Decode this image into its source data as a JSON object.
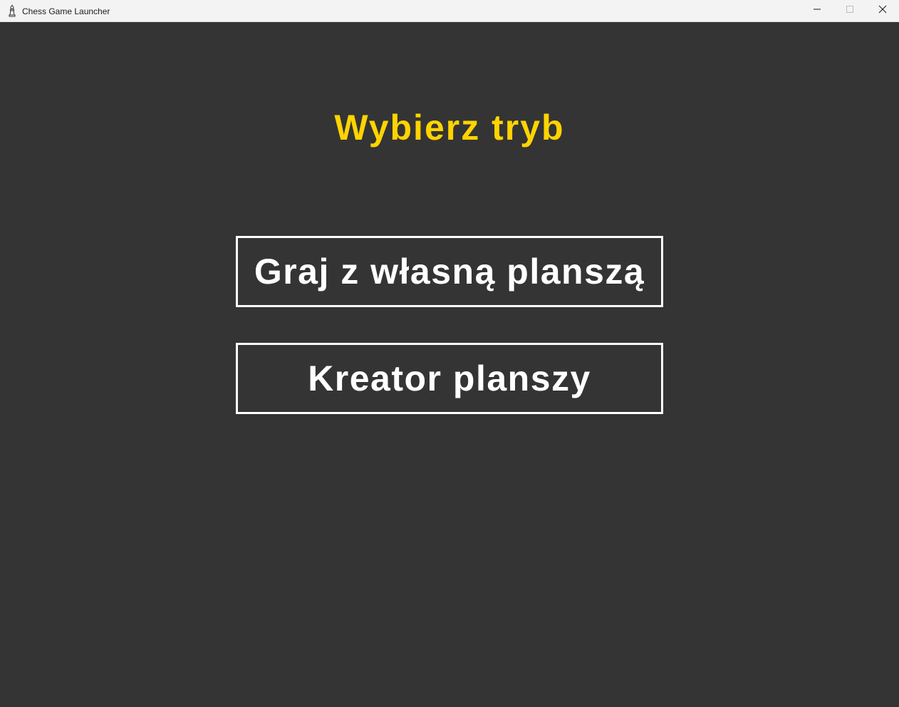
{
  "window": {
    "title": "Chess Game Launcher",
    "icon": "chess-piece-icon",
    "controls": {
      "minimize_icon": "minimize-icon",
      "maximize_icon": "maximize-icon",
      "close_icon": "close-icon"
    }
  },
  "main": {
    "heading": "Wybierz tryb",
    "buttons": [
      {
        "label": "Graj z własną planszą"
      },
      {
        "label": "Kreator planszy"
      }
    ]
  },
  "colors": {
    "background": "#343434",
    "heading": "#ffd400",
    "button_text": "#ffffff",
    "button_border": "#ffffff",
    "titlebar": "#f3f3f3"
  }
}
